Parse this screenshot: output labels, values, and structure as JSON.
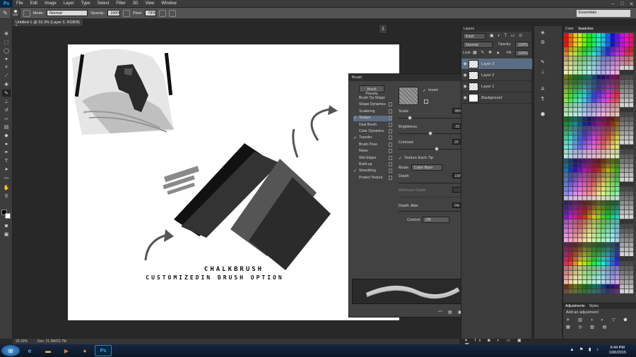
{
  "app": {
    "logo": "Ps",
    "menu": [
      "File",
      "Edit",
      "Image",
      "Layer",
      "Type",
      "Select",
      "Filter",
      "3D",
      "View",
      "Window"
    ],
    "workspace": "Essentials"
  },
  "options": {
    "brush_size": "400",
    "mode_label": "Mode:",
    "mode_value": "Normal",
    "opacity_label": "Opacity:",
    "opacity_value": "100%",
    "flow_label": "Flow:",
    "flow_value": "78%"
  },
  "document": {
    "tab": "Untitled-1 @ 33.3% (Layer 3, RGB/8) *",
    "zoom": "33.33%",
    "doc_info": "Doc: 21.9M/23.7M"
  },
  "artwork": {
    "title": "CHALKBRUSH",
    "subtitle": "CUSTOMIZEDIN BRUSH OPTION"
  },
  "brush": {
    "panel_title": "Brush",
    "presets_button": "Brush Presets",
    "items": [
      {
        "label": "Brush Tip Shape",
        "checked": false,
        "lock": false
      },
      {
        "label": "Shape Dynamics",
        "checked": false,
        "lock": true
      },
      {
        "label": "Scattering",
        "checked": false,
        "lock": true
      },
      {
        "label": "Texture",
        "checked": true,
        "lock": true,
        "selected": true
      },
      {
        "label": "Dual Brush",
        "checked": false,
        "lock": true
      },
      {
        "label": "Color Dynamics",
        "checked": false,
        "lock": true
      },
      {
        "label": "Transfer",
        "checked": true,
        "lock": true
      },
      {
        "label": "Brush Pose",
        "checked": false,
        "lock": true
      },
      {
        "label": "Noise",
        "checked": false,
        "lock": true
      },
      {
        "label": "Wet Edges",
        "checked": false,
        "lock": true
      },
      {
        "label": "Build-up",
        "checked": false,
        "lock": true
      },
      {
        "label": "Smoothing",
        "checked": true,
        "lock": true
      },
      {
        "label": "Protect Texture",
        "checked": false,
        "lock": true
      }
    ],
    "invert_label": "Invert",
    "scale_label": "Scale",
    "scale_value": "28%",
    "brightness_label": "Brightness",
    "brightness_value": "-20",
    "contrast_label": "Contrast",
    "contrast_value": "29",
    "texture_each_tip": "Texture Each Tip",
    "mode_label": "Mode:",
    "mode_value": "Color Burn",
    "depth_label": "Depth",
    "depth_value": "100%",
    "min_depth_label": "Minimum Depth",
    "depth_jitter_label": "Depth Jitter",
    "depth_jitter_value": "0%",
    "control_label": "Control:",
    "control_value": "Off"
  },
  "layers": {
    "tab": "Layers",
    "kind": "Kind",
    "blend": "Normal",
    "opacity_label": "Opacity:",
    "opacity_value": "100%",
    "lock_label": "Lock:",
    "fill_label": "Fill:",
    "fill_value": "100%",
    "items": [
      {
        "name": "Layer 3",
        "selected": true
      },
      {
        "name": "Layer 2",
        "selected": false
      },
      {
        "name": "Layer 1",
        "selected": false
      },
      {
        "name": "Background",
        "selected": false
      }
    ]
  },
  "swatches": {
    "tab_color": "Color",
    "tab_swatches": "Swatches"
  },
  "adjustments": {
    "tab_adj": "Adjustments",
    "tab_styles": "Styles",
    "add_label": "Add an adjustment"
  },
  "taskbar": {
    "time": "9:44 PM",
    "date": "10/6/2015"
  }
}
